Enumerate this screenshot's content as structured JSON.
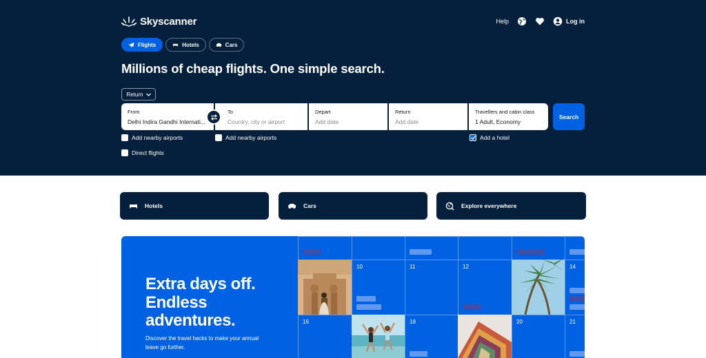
{
  "brand": {
    "name": "Skyscanner"
  },
  "topnav": {
    "help": "Help",
    "login": "Log in"
  },
  "tabs": [
    {
      "label": "Flights",
      "icon": "plane-icon",
      "active": true
    },
    {
      "label": "Hotels",
      "icon": "bed-icon",
      "active": false
    },
    {
      "label": "Cars",
      "icon": "car-icon",
      "active": false
    }
  ],
  "headline": "Millions of cheap flights. One simple search.",
  "search": {
    "trip_type": "Return",
    "from": {
      "label": "From",
      "value": "Delhi Indira Gandhi Internati..."
    },
    "to": {
      "label": "To",
      "placeholder": "Country, city or airport"
    },
    "depart": {
      "label": "Depart",
      "placeholder": "Add date"
    },
    "return": {
      "label": "Return",
      "placeholder": "Add date"
    },
    "travellers": {
      "label": "Travellers and cabin class",
      "value": "1 Adult, Economy"
    },
    "button": "Search",
    "nearby_from": {
      "label": "Add nearby airports",
      "checked": false
    },
    "nearby_to": {
      "label": "Add nearby airports",
      "checked": false
    },
    "direct": {
      "label": "Direct flights",
      "checked": false
    },
    "hotel": {
      "label": "Add a hotel",
      "checked": true
    }
  },
  "quicklinks": [
    {
      "label": "Hotels",
      "icon": "bed-icon"
    },
    {
      "label": "Cars",
      "icon": "car-icon"
    },
    {
      "label": "Explore everywhere",
      "icon": "globe-search-icon"
    }
  ],
  "promo": {
    "title_line1": "Extra days off.",
    "title_line2": "Endless",
    "title_line3": "adventures.",
    "subtitle": "Discover the travel hacks to make your annual leave go further.",
    "calendar_days": [
      "10",
      "11",
      "12",
      "14",
      "16",
      "18",
      "20",
      "21"
    ]
  },
  "colors": {
    "navy": "#05203c",
    "blue": "#0062e3",
    "white": "#ffffff"
  }
}
